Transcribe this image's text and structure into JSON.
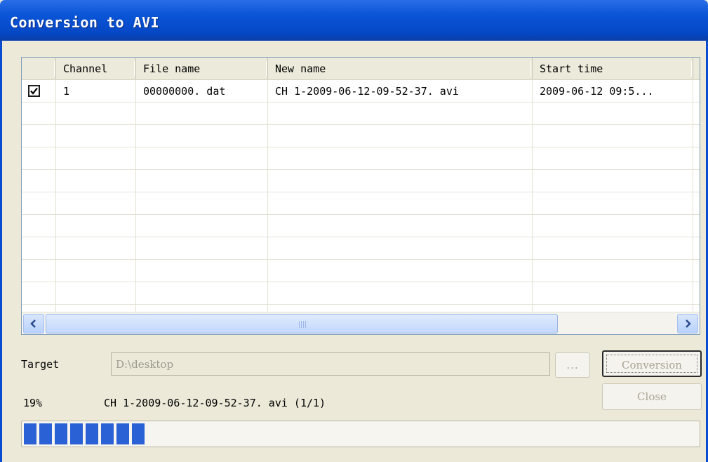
{
  "window": {
    "title": "Conversion to AVI"
  },
  "table": {
    "columns": [
      "",
      "Channel",
      "File name",
      "New name",
      "Start time"
    ],
    "rows": [
      {
        "checked": true,
        "channel": "1",
        "file_name": "00000000. dat",
        "new_name": "CH 1-2009-06-12-09-52-37. avi",
        "start_time": "2009-06-12 09:5..."
      }
    ]
  },
  "scrollbar": {
    "grip": "IIII"
  },
  "target": {
    "label": "Target",
    "value": "D:\\desktop"
  },
  "buttons": {
    "browse": "...",
    "conversion": "Conversion",
    "close": "Close"
  },
  "status": {
    "percent_text": "19%",
    "current_file": "CH 1-2009-06-12-09-52-37. avi  (1/1)"
  },
  "progress": {
    "value": 0.19,
    "color": "#2a62d6"
  }
}
